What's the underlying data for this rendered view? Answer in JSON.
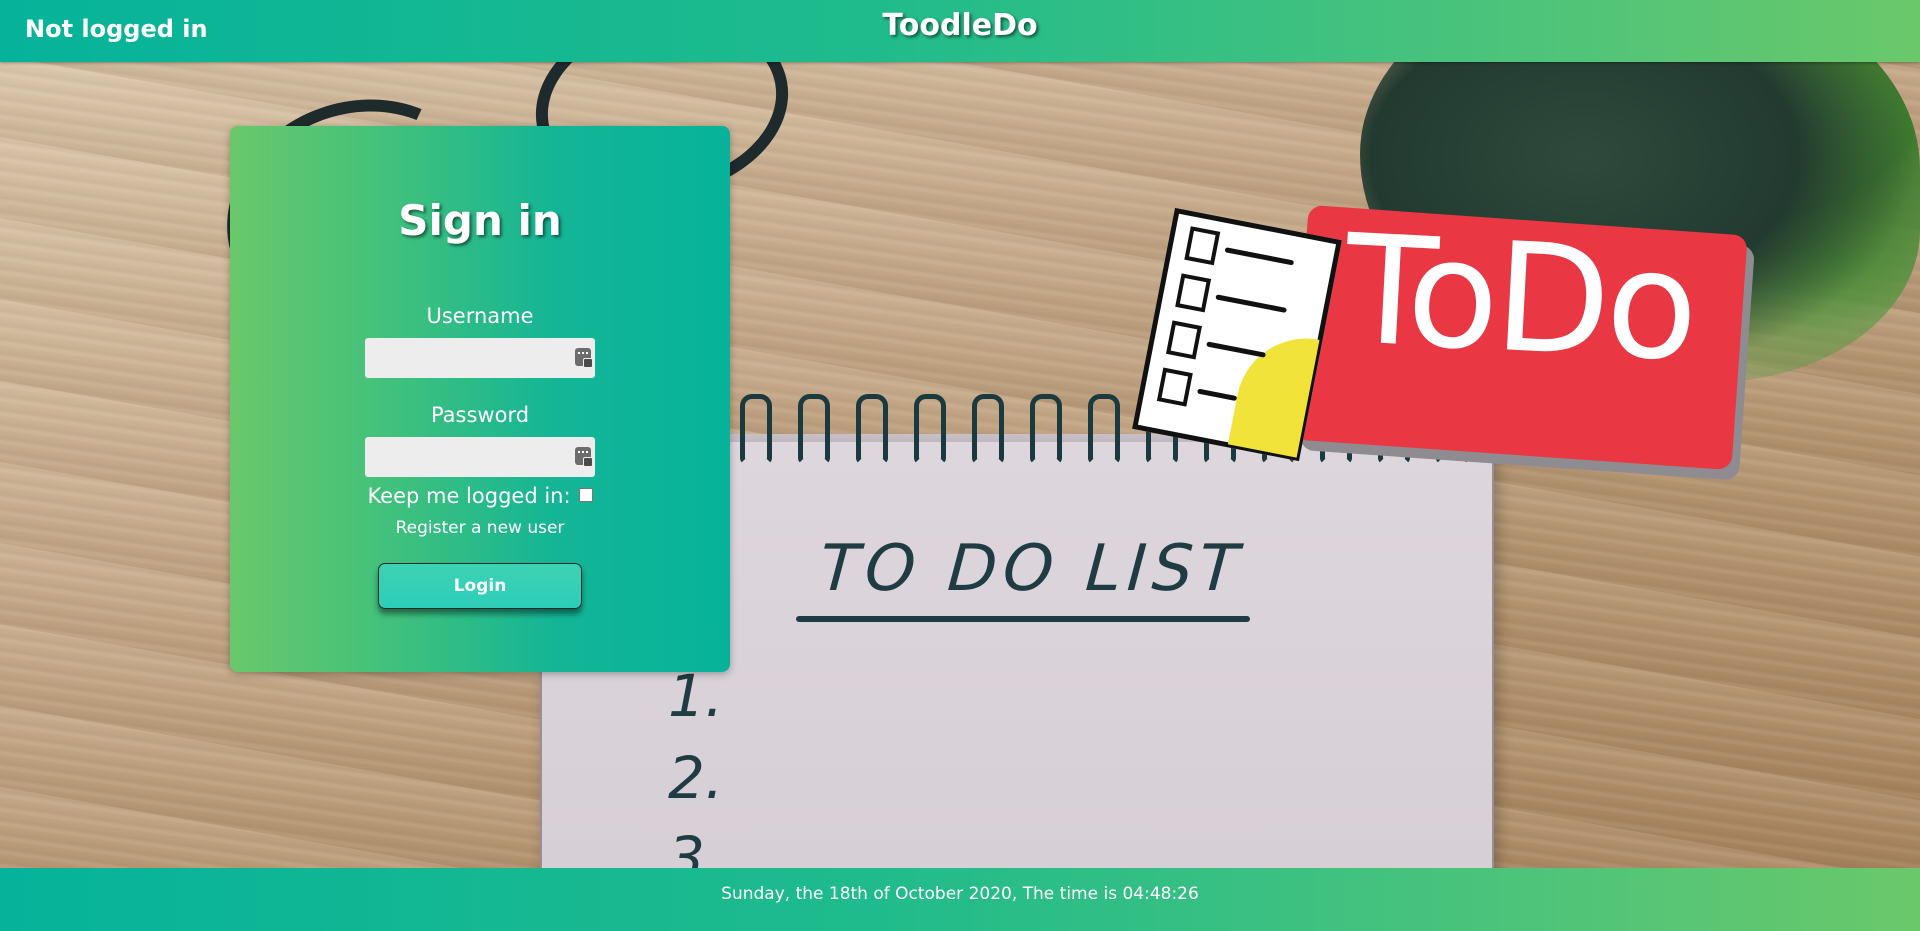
{
  "header": {
    "status": "Not logged in",
    "brand": "ToodleDo"
  },
  "background": {
    "sticker_text": "ToDo",
    "notebook_title": "TO DO LIST",
    "notebook_items": [
      "1.",
      "2.",
      "3"
    ]
  },
  "signin": {
    "title": "Sign in",
    "username_label": "Username",
    "username_value": "",
    "password_label": "Password",
    "password_value": "",
    "keep_logged_in_label": "Keep me logged in:",
    "keep_logged_in_checked": false,
    "register_link": "Register a new user",
    "login_button": "Login",
    "field_icon": "password-manager-key-icon"
  },
  "footer": {
    "datetime": "Sunday, the 18th of October 2020, The time is 04:48:26"
  },
  "colors": {
    "gradient_teal": "#06b39a",
    "gradient_green": "#6ac86a",
    "login_button": "#2ccdb9",
    "sticker_red": "#e93743"
  }
}
